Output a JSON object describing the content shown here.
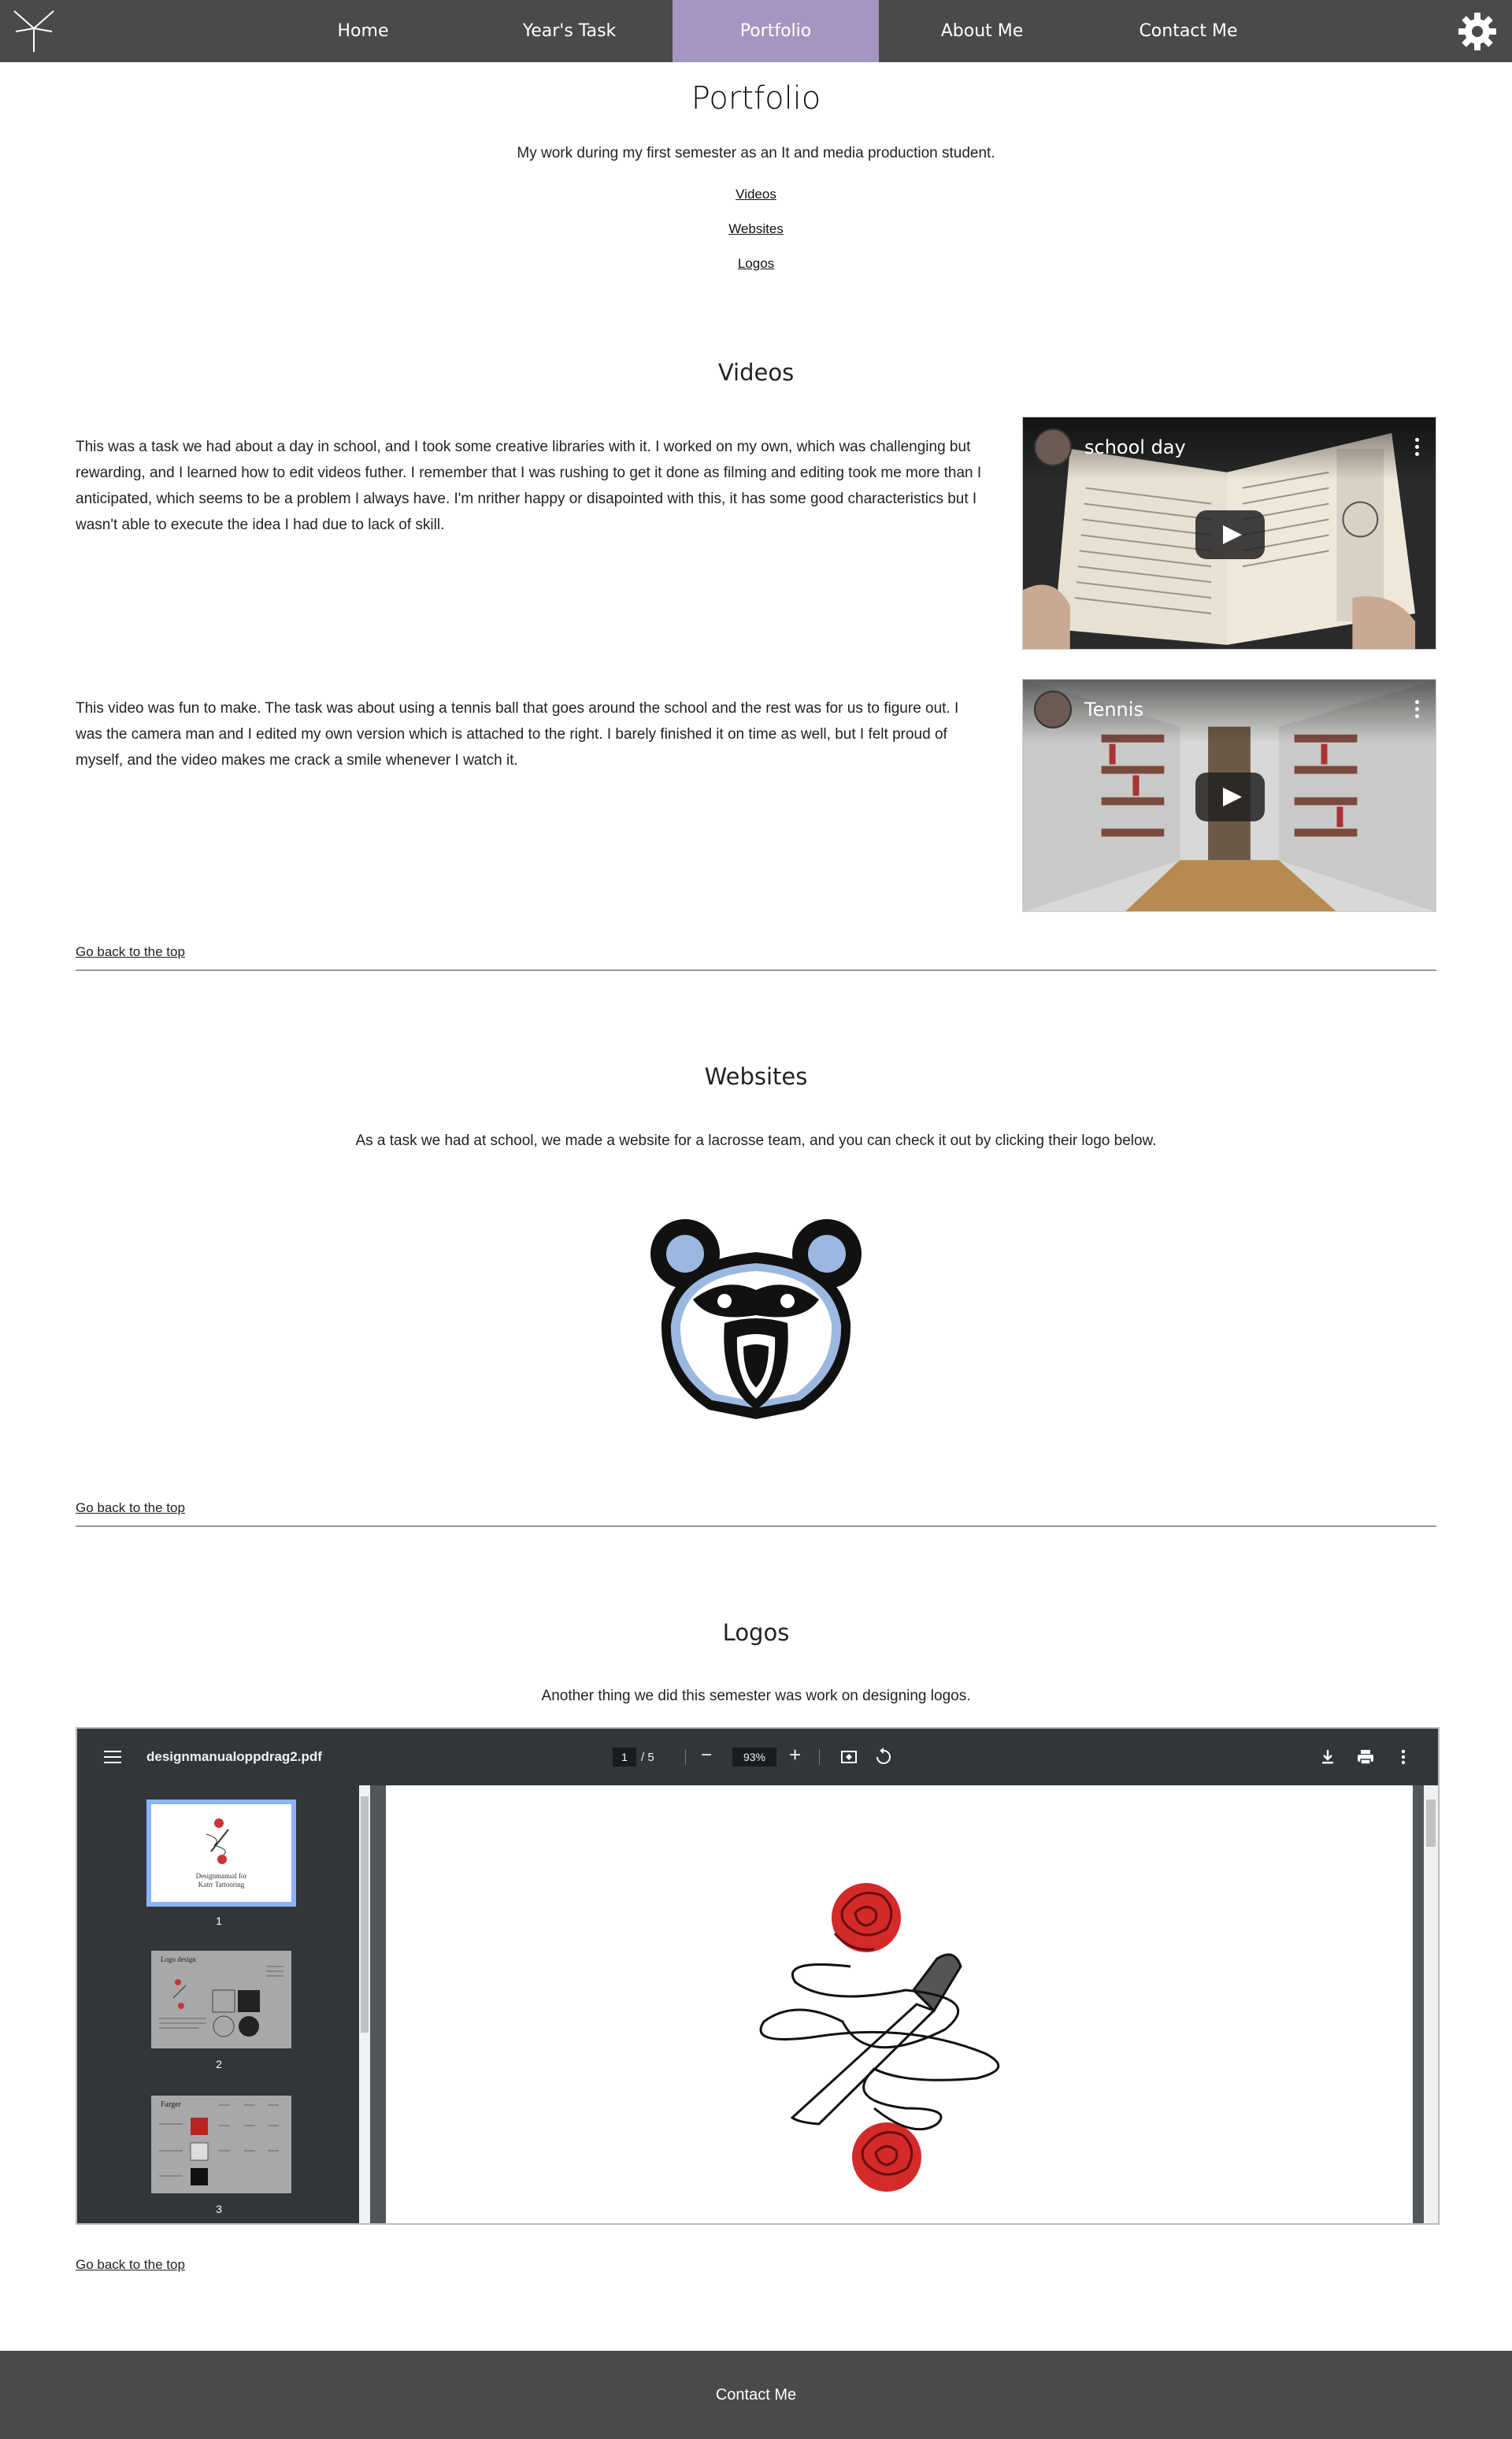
{
  "nav": {
    "items": [
      {
        "label": "Home"
      },
      {
        "label": "Year's Task"
      },
      {
        "label": "Portfolio"
      },
      {
        "label": "About Me"
      },
      {
        "label": "Contact Me"
      }
    ],
    "active_index": 2
  },
  "header": {
    "title": "Portfolio",
    "intro": "My work during my first semester as an It and media production student.",
    "links": [
      "Videos",
      "Websites",
      "Logos"
    ]
  },
  "videos": {
    "heading": "Videos",
    "items": [
      {
        "text": "This was a task we had about a day in school, and I took some creative libraries with it. I worked on my own, which was challenging but rewarding, and I learned how to edit videos futher. I remember that I was rushing to get it done as filming and editing took me more than I anticipated, which seems to be a problem I always have. I'm nrither happy or disapointed with this, it has some good characteristics but I wasn't able to execute the idea I had due to lack of skill.",
        "video_title": "school day"
      },
      {
        "text": "This video was fun to make. The task was about using a tennis ball that goes around the school and the rest was for us to figure out. I was the camera man and I edited my own version which is attached to the right. I barely finished it on time as well, but I felt proud of myself, and the video makes me crack a smile whenever I watch it.",
        "video_title": "Tennis"
      }
    ],
    "back_link": "Go back to the top"
  },
  "websites": {
    "heading": "Websites",
    "text": "As a task we had at school, we made a website for a lacrosse team, and you can check it out by clicking their logo below.",
    "back_link": "Go back to the top"
  },
  "logos": {
    "heading": "Logos",
    "text": "Another thing we did this semester was work on designing logos.",
    "pdf": {
      "filename": "designmanualoppdrag2.pdf",
      "current_page": "1",
      "page_of": "/  5",
      "zoom": "93%",
      "thumbnails": [
        "1",
        "2",
        "3"
      ],
      "thumb1_caption": "Designmanual for\nKatrr Tattooring",
      "thumb2_title": "Logo design",
      "thumb3_title": "Farger"
    },
    "back_link": "Go back to the top"
  },
  "footer": {
    "label": "Contact Me"
  }
}
